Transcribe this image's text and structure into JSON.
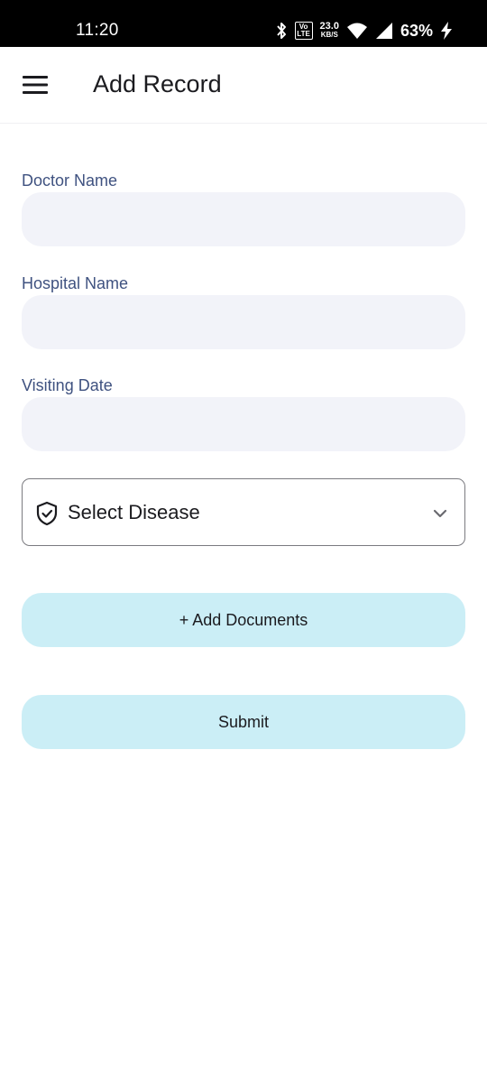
{
  "status_bar": {
    "time": "11:20",
    "volte_top": "Vo",
    "volte_bottom": "LTE",
    "network_speed": "23.0",
    "network_speed_unit": "KB/S",
    "battery": "63%",
    "icons": [
      "bluetooth-icon",
      "volte-icon",
      "wifi-icon",
      "signal-icon",
      "charging-icon"
    ]
  },
  "app_bar": {
    "menu_icon": "hamburger-menu-icon",
    "title": "Add Record"
  },
  "form": {
    "doctor_name": {
      "label": "Doctor Name",
      "value": ""
    },
    "hospital_name": {
      "label": "Hospital Name",
      "value": ""
    },
    "visiting_date": {
      "label": "Visiting Date",
      "value": ""
    },
    "disease_select": {
      "icon": "shield-check-icon",
      "selected": "Select Disease",
      "chevron": "chevron-down-icon"
    },
    "add_documents_label": "+ Add Documents",
    "submit_label": "Submit"
  },
  "colors": {
    "label": "#3f5280",
    "field_bg": "#f2f3f9",
    "button_bg": "#cbeef6",
    "status_bar_bg": "#000000"
  }
}
